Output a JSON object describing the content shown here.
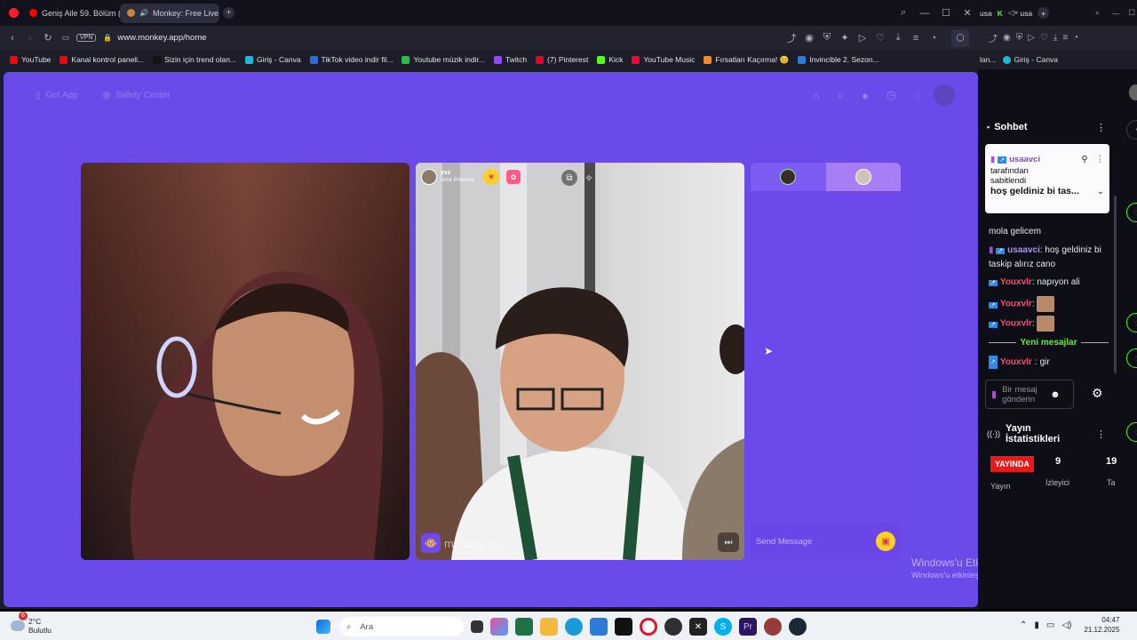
{
  "tabs": [
    {
      "title": "Geniş Aile 59. Bölüm (FUL...",
      "icon": "youtube-icon"
    },
    {
      "title": "Monkey: Free Live Vid...",
      "icon": "monkey-icon"
    }
  ],
  "right_tabs": [
    {
      "title": "usa"
    },
    {
      "title": "usa"
    }
  ],
  "address": {
    "url": "www.monkey.app/home",
    "vpn": "VPN"
  },
  "bookmarks": [
    {
      "label": "YouTube",
      "color": "#ff0000"
    },
    {
      "label": "Kanal kontrol paneli...",
      "color": "#ff0000"
    },
    {
      "label": "Sizin için trend olan...",
      "color": "#111111"
    },
    {
      "label": "Giriş - Canva",
      "color": "#1fb7d6"
    },
    {
      "label": "TikTok video indir fil...",
      "color": "#2b6be8"
    },
    {
      "label": "Youtube müzik indir...",
      "color": "#27c04b"
    },
    {
      "label": "Twitch",
      "color": "#9146ff"
    },
    {
      "label": "(7) Pinterest",
      "color": "#e60023"
    },
    {
      "label": "Kick",
      "color": "#53fc18"
    },
    {
      "label": "YouTube Music",
      "color": "#ff0033"
    },
    {
      "label": "Fırsatları Kaçırma! 😊",
      "color": "#f28a2a"
    },
    {
      "label": "Invincible 2. Sezon...",
      "color": "#2d7bd8"
    }
  ],
  "right_bookmarks": [
    {
      "label": "lan..."
    },
    {
      "label": "Giriş - Canva"
    }
  ],
  "monkey": {
    "get_app": "Get App",
    "safety": "Safety Center",
    "peer": {
      "name": "yxz",
      "location": "İzmir Province"
    },
    "watermark": "monkey.app",
    "send_placeholder": "Send Message"
  },
  "chat": {
    "title": "Sohbet",
    "pinned_user": "usaavci",
    "pinned_by": "tarafından",
    "pinned_label": "sabitlendi",
    "pinned_text": "hoş geldiniz bi tas...",
    "messages": [
      {
        "user": "",
        "text": "mola gelicem",
        "type": "plain"
      },
      {
        "user": "usaavci",
        "text": "hoş geldiniz bi taskip alırız cano",
        "type": "purple"
      },
      {
        "user": "Youxvlr",
        "text": "napıyon ali",
        "type": "red"
      },
      {
        "user": "Youxvlr",
        "text": "",
        "type": "red-emote"
      },
      {
        "user": "Youxvlr",
        "text": "",
        "type": "red-emote"
      }
    ],
    "divider": "Yeni mesajlar",
    "after": [
      {
        "user": "Youxvlr",
        "text": "gir"
      }
    ],
    "input_placeholder": "Bir mesaj gönderin"
  },
  "stats": {
    "title": "Yayın İstatistikleri",
    "live": "YAYINDA",
    "viewers": "9",
    "viewers_label": "İzleyici",
    "third": "19",
    "third_label": "Ta",
    "first_label": "Yayın"
  },
  "watermark": {
    "title": "Windows'u Etkinleştir",
    "subtitle": "Windows'u etkinleştirmek için Ayarlar'a gidin."
  },
  "taskbar": {
    "weather_temp": "2°C",
    "weather_desc": "Bulutlu",
    "badge": "6",
    "search": "Ara",
    "time": "04:47",
    "date": "21.12.2025"
  }
}
